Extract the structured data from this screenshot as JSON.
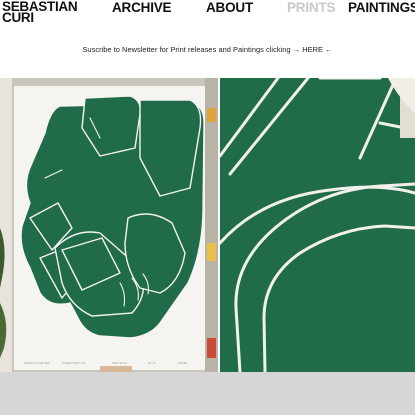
{
  "brand": {
    "name": "SEBASTIAN CURI"
  },
  "nav": {
    "archive": "ARCHIVE",
    "about": "ABOUT",
    "prints": "PRINTS",
    "paintings": "PAINTINGS"
  },
  "newsletter": {
    "text": "Suscribe to Newsletter for Print releases and Paintings clicking",
    "cta": "→ HERE ←"
  },
  "gallery": {
    "images": [
      {
        "icon": "green-hand-print-artwork"
      },
      {
        "icon": "green-print-detail-closeup"
      }
    ]
  },
  "colors": {
    "print_green": "#1f6b4a",
    "paper": "#f4f3ef",
    "active_nav": "#c9c9c9"
  }
}
